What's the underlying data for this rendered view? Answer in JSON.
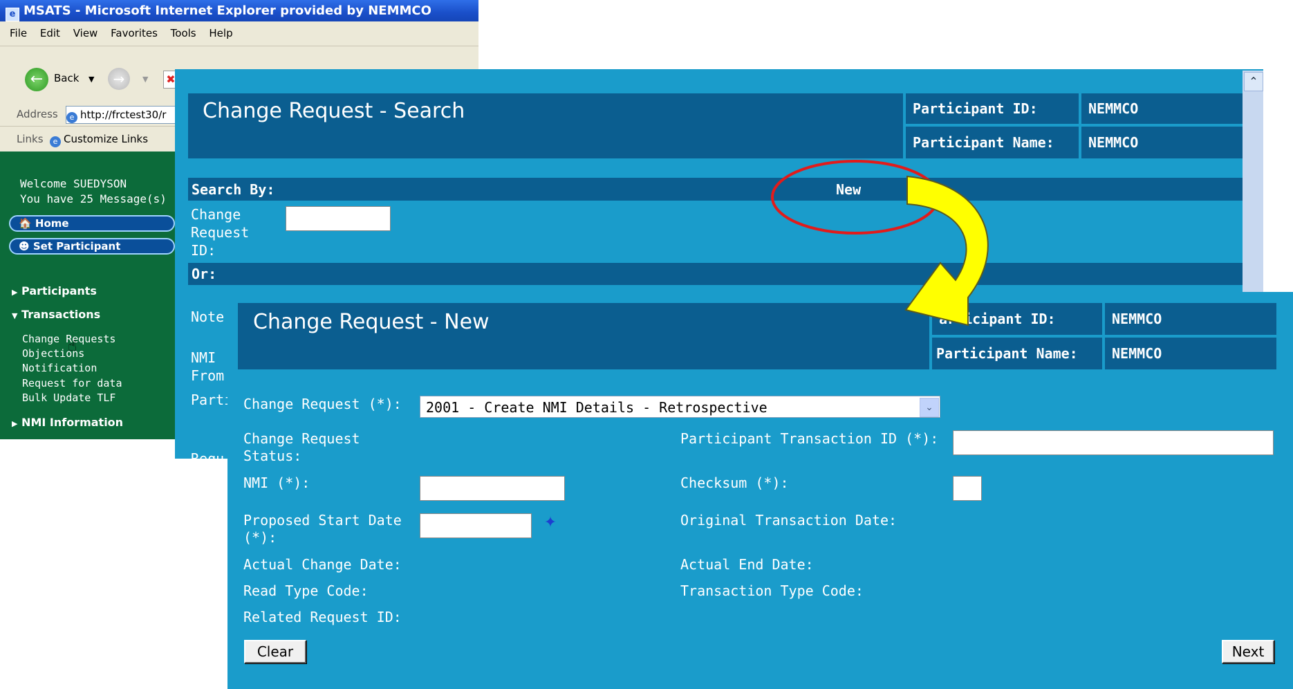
{
  "browser": {
    "title": "MSATS - Microsoft Internet Explorer provided by NEMMCO",
    "menu": [
      "File",
      "Edit",
      "View",
      "Favorites",
      "Tools",
      "Help"
    ],
    "back_label": "Back",
    "address_label": "Address",
    "address_value": "http://frctest30/r",
    "links_label": "Links",
    "customize_links": "Customize Links"
  },
  "sidebar": {
    "welcome": "Welcome SUEDYSON",
    "messages": "You have 25 Message(s)",
    "home": "Home",
    "set_participant": "Set Participant",
    "participants": "Participants",
    "transactions": "Transactions",
    "links": [
      "Change Requests",
      "Objections",
      "Notification",
      "Request for data",
      "Bulk Update TLF"
    ],
    "nmi_information": "NMI Information"
  },
  "search_window": {
    "title": "Change Request - Search",
    "participant_id_label": "Participant ID:",
    "participant_id": "NEMMCO",
    "participant_name_label": "Participant Name:",
    "participant_name": "NEMMCO",
    "search_by": "Search By:",
    "new_link": "New",
    "change_request_id_label": "Change\nRequest\nID:",
    "or_label": "Or:",
    "partial_labels": [
      "Note",
      "NMI",
      "From",
      "Parti",
      "Requ"
    ]
  },
  "new_window": {
    "title": "Change Request - New",
    "participant_id_label": "articipant ID:",
    "participant_id": "NEMMCO",
    "participant_name_label": "Participant Name:",
    "participant_name": "NEMMCO",
    "change_request_label": "Change Request (*):",
    "change_request_value": "2001 - Create NMI Details - Retrospective",
    "status_label": "Change Request\nStatus:",
    "participant_transaction_id_label": "Participant Transaction ID (*):",
    "nmi_label": "NMI (*):",
    "checksum_label": "Checksum (*):",
    "proposed_start_date_label": "Proposed Start Date\n(*):",
    "original_transaction_date_label": "Original Transaction Date:",
    "actual_change_date_label": "Actual Change Date:",
    "actual_end_date_label": "Actual End Date:",
    "read_type_code_label": "Read Type Code:",
    "transaction_type_code_label": "Transaction Type Code:",
    "related_request_id_label": "Related Request ID:",
    "clear_button": "Clear",
    "next_button": "Next"
  },
  "icons": {
    "highlight_ring": "red-ellipse",
    "flow_arrow": "yellow-curved-arrow",
    "calendar": "calendar-icon"
  },
  "colors": {
    "panel_bg": "#1a9ccb",
    "header_bg": "#0b5e90",
    "sidebar_bg": "#0c6b3a",
    "highlight": "#e21b1b",
    "arrow_fill": "#ffff00"
  }
}
